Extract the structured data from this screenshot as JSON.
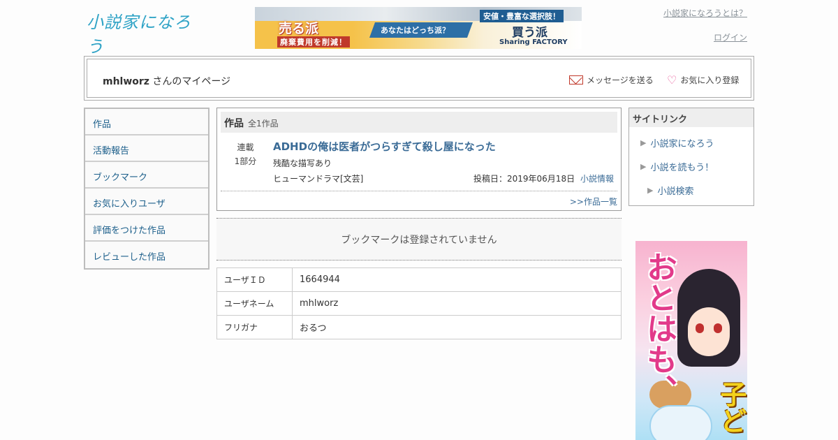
{
  "header": {
    "logo_text": "小説家になろう",
    "about_link": "小説家になろうとは？",
    "login_link": "ログイン"
  },
  "banner": {
    "sell": "売る派",
    "sell_sub": "廃棄費用を削減！",
    "question": "あなたはどっち派？",
    "cheap": "安値・豊富な選択肢！",
    "buy": "買う派",
    "brand": "Sharing FACTORY"
  },
  "userbar": {
    "username": "mhlworz",
    "suffix": "さんのマイページ",
    "send_message": "メッセージを送る",
    "add_favorite": "お気に入り登録"
  },
  "menu": {
    "items": [
      {
        "label": "作品"
      },
      {
        "label": "活動報告"
      },
      {
        "label": "ブックマーク"
      },
      {
        "label": "お気に入りユーザ"
      },
      {
        "label": "評価をつけた作品"
      },
      {
        "label": "レビューした作品"
      }
    ]
  },
  "works": {
    "heading": "作品",
    "count": "全1作品",
    "series_type": "連載",
    "parts": "1部分",
    "title": "ADHDの俺は医者がつらすぎて殺し屋になった",
    "warning": "残酷な描写あり",
    "genre": "ヒューマンドラマ[文芸]",
    "posted": "投稿日：2019年06月18日",
    "info_link": "小説情報",
    "list_link": ">>作品一覧"
  },
  "bookmark": {
    "empty_message": "ブックマークは登録されていません"
  },
  "profile": {
    "rows": [
      {
        "key": "ユーザＩＤ",
        "value": "1664944"
      },
      {
        "key": "ユーザネーム",
        "value": "mhlworz"
      },
      {
        "key": "フリガナ",
        "value": "おるつ"
      }
    ]
  },
  "sitelink": {
    "heading": "サイトリンク",
    "items": [
      {
        "label": "小説家になろう"
      },
      {
        "label": "小説を読もう！"
      },
      {
        "label": "小説検索"
      }
    ]
  },
  "side_ad": {
    "main_text": "おとはも、",
    "sub_text": "子ど"
  },
  "colors": {
    "link": "#3a6b96",
    "menu_link": "#1b5e8a",
    "logo": "#2fa3c6",
    "heart": "#e85a9a",
    "mail": "#c0392b"
  }
}
